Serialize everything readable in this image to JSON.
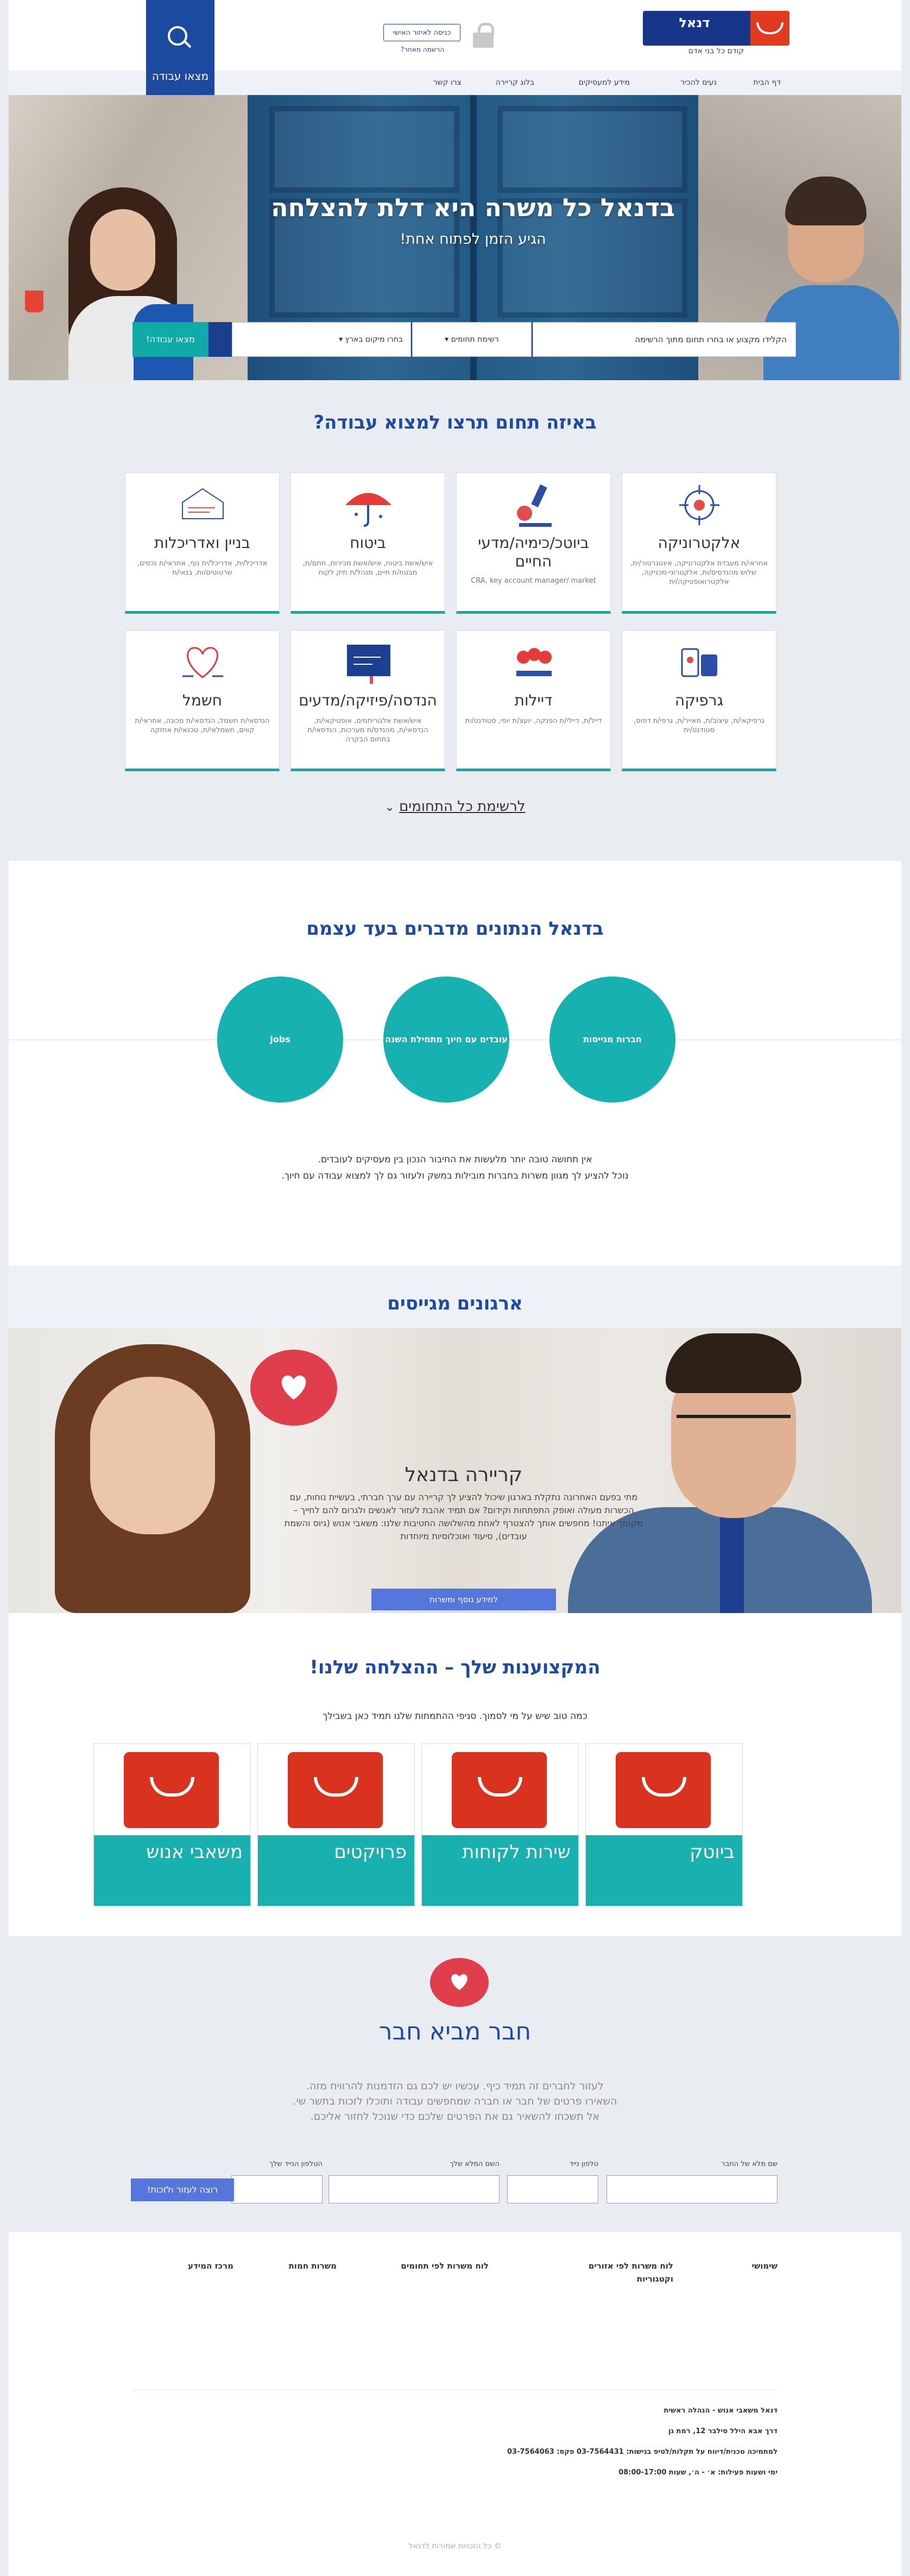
{
  "header": {
    "logo_text": "דנאל",
    "logo_tagline": "קודם כל בני אדם",
    "login_button": "כניסה לאיזור האישי",
    "register_link": "הרשמה מאחר?",
    "find_job_label": "מצאו עבודה"
  },
  "nav": {
    "items": [
      "דף הבית",
      "נעים להכיר",
      "מידע למעסיקים",
      "בלוג קריירה",
      "צרו קשר"
    ]
  },
  "hero": {
    "title": "בדנאל כל משרה היא דלת להצלחה",
    "subtitle": "הגיע הזמן לפתוח אחת!",
    "search": {
      "keyword_placeholder": "הקלידו מקצוע או בחרו תחום מתוך הרשימה",
      "field_select": "רשימת תחומים",
      "area_select": "בחרו מיקום בארץ",
      "submit": "מצאו עבודה!"
    }
  },
  "categories": {
    "title": "באיזה תחום תרצו למצוא עבודה?",
    "cards": [
      {
        "title": "אלקטרוניקה",
        "desc": "אחראי/ת מעבדת אלקטרוניקה, אינטגרטור/ית, שלוש מהנדסים/ות, אלקטרוני-מכניקה, אלקטרואופטיקה/ית"
      },
      {
        "title": "ביוטכ/כימיה/מדעי החיים",
        "desc": "CRA, key account manager/ market"
      },
      {
        "title": "ביטוח",
        "desc": "איש/אשת ביטוח, איש/אשת מכירות, חתם/ת, מבטח/ת חיים, מנהל/ת תיק לקוח"
      },
      {
        "title": "בניין ואדריכלות",
        "desc": "אדריכל/ית, אדריכל/ית נוף, אחראי/ת נכסים, שרטוטים/ות, בנאי/ת"
      },
      {
        "title": "גרפיקה",
        "desc": "גרפיקאי/ת, עיצוב/ת, מאייר/ת, גרפי/ת דפוס, סטודנט/ית"
      },
      {
        "title": "דיילות",
        "desc": "דייל/ת, דיילי/ת הפנקה, יועצ/ת יופי, סטודנט/ית"
      },
      {
        "title": "הנדסה/פיזיקה/מדעים",
        "desc": "איש/אשת אלגוריתמים, אופטיקאי/ת, הנדסאי/ת, מהנדס/ת מערכות, הנדסאי/ת בתחום הבקרה"
      },
      {
        "title": "חשמל",
        "desc": "הנדסאי/ת חשמל, הנדסאי/ת מכונה, אחראי/ת קווים, חשמלאי/ת, טכנאי/ת אחזקה"
      }
    ],
    "all_link": "לרשימת כל התחומים"
  },
  "speaks": {
    "title": "בדנאל הנתונים מדברים בעד עצמם",
    "circles": [
      "חברות מגייסות",
      "עובדים עם חיוך מתחילת השנה",
      "jobs"
    ],
    "text_line1": "אין תחושה טובה יותר מלעשות את החיבור הנכון בין מעסיקים לעובדים.",
    "text_line2": "נוכל להציע לך מגוון משרות בחברות מובילות במשק ולעזור גם לך למצוא עבודה עם חיוך."
  },
  "recruiting": {
    "title": "ארגונים מגייסים",
    "career_title": "קריירה בדנאל",
    "career_text": "מתי בפעם האחרונה נתקלת בארגון שיכול להציע לך קריירה עם ערך חברתי, בעשיית נוחות, עם הכשרות מעולה ואופק התפתחות וקידום? אם תמיד אהבת לעזור לאנשים ולגרום להם לחייך – מקומך איתנו! מחפשים אותך להצטרף לאחת מהשלושה החטיבות שלנו: משאבי אנוש (גיוס והשמת עובדים), סיעוד ואוכלוסיות מיוחדות",
    "career_button": "למידע נוסף ומשרות"
  },
  "specialties": {
    "title": "המקצוענות שלך – ההצלחה שלנו!",
    "subtitle": "כמה טוב שיש על מי לסמוך. סניפי ההתמחות שלנו תמיד כאן בשבילך",
    "cards": [
      "ביוטק",
      "שירות לקוחות",
      "פרויקטים",
      "משאבי אנוש"
    ]
  },
  "refer": {
    "title": "חבר מביא חבר",
    "line1": "לעזור לחברים זה תמיד כיף. עכשיו יש לכם גם הזדמנות להרוויח מזה.",
    "line2": "השאירו פרטים של חבר או חברה שמחפשים עבודה ותוכלו לזכות בתשר שי.",
    "line3": "אל תשכחו להשאיר גם את הפרטים שלכם כדי שנוכל לחזור אליכם.",
    "fields": [
      "שם מלא של החבר",
      "טלפון נייד",
      "השם המלא שלך",
      "הטלפון הנייד שלך"
    ],
    "submit": "רוצה לעזור ולזכות!"
  },
  "footer": {
    "columns": [
      "שימושי",
      "לוח משרות לפי אזורים וקטגוריות",
      "לוח משרות לפי תחומים",
      "משרות חמות",
      "מרכז המידע"
    ],
    "company": "דנאל משאבי אנוש - הנהלה ראשית",
    "address": "דרך אבא הילל סילבר 12, רמת גן",
    "phone": "למתמיכה טכנית/דיווח על תקלות/לטיפ בגישות: 03-7564431 פקס: 03-7564063",
    "hours": "ימי ושעות פעילות: א׳ - ה׳, שעות 08:00-17:00",
    "copyright": "© כל הזכויות שמורות לדנאל"
  }
}
